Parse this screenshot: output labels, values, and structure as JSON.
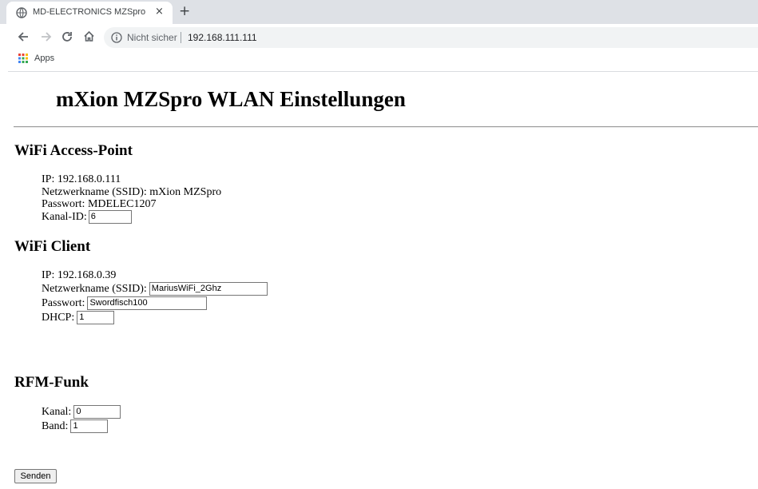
{
  "browser": {
    "tab_title": "MD-ELECTRONICS MZSpro",
    "tab_close": "×",
    "new_tab": "+",
    "not_secure": "Nicht sicher",
    "url": "192.168.111.111",
    "bookmark_apps": "Apps",
    "icons": [
      "globe-icon",
      "close-icon",
      "plus-icon",
      "back-arrow-icon",
      "forward-arrow-icon",
      "reload-icon",
      "home-icon",
      "info-icon",
      "apps-grid-icon"
    ]
  },
  "page": {
    "title": "mXion MZSpro WLAN Einstellungen",
    "ap": {
      "heading": "WiFi Access-Point",
      "ip_label": "IP:",
      "ip": "192.168.0.111",
      "ssid_label": "Netzwerkname (SSID):",
      "ssid": "mXion MZSpro",
      "password_label": "Passwort:",
      "password": "MDELEC1207",
      "channel_label": "Kanal-ID:",
      "channel_value": "6"
    },
    "client": {
      "heading": "WiFi Client",
      "ip_label": "IP:",
      "ip": "192.168.0.39",
      "ssid_label": "Netzwerkname (SSID):",
      "ssid_value": "MariusWiFi_2Ghz",
      "password_label": "Passwort:",
      "password_value": "Swordfisch100",
      "dhcp_label": "DHCP:",
      "dhcp_value": "1"
    },
    "rfm": {
      "heading": "RFM-Funk",
      "channel_label": "Kanal:",
      "channel_value": "0",
      "band_label": "Band:",
      "band_value": "1"
    },
    "submit_label": "Senden"
  }
}
